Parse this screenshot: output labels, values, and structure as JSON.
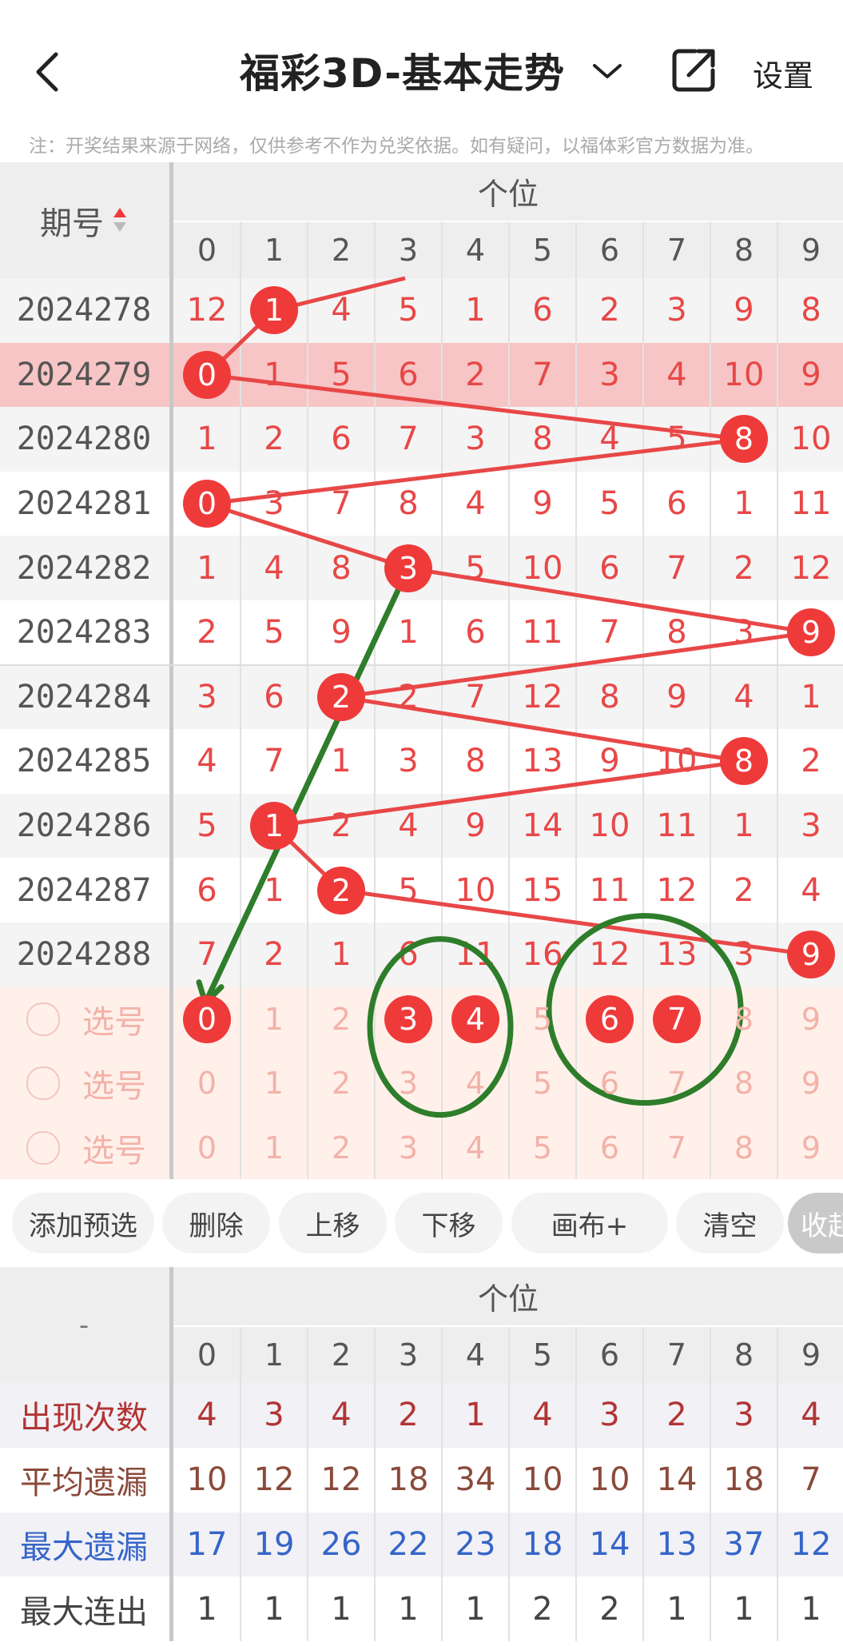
{
  "header": {
    "title": "福彩3D-基本走势",
    "settings_label": "设置",
    "note": "注：开奖结果来源于网络，仅供参考不作为兑奖依据。如有疑问，以福体彩官方数据为准。"
  },
  "table": {
    "period_header": "期号",
    "group_header": "个位",
    "digits": [
      "0",
      "1",
      "2",
      "3",
      "4",
      "5",
      "6",
      "7",
      "8",
      "9"
    ],
    "rows": [
      {
        "period": "2024278",
        "winner": 1,
        "cells": [
          "12",
          "1",
          "4",
          "5",
          "1",
          "6",
          "2",
          "3",
          "9",
          "8"
        ]
      },
      {
        "period": "2024279",
        "winner": 0,
        "cells": [
          "0",
          "1",
          "5",
          "6",
          "2",
          "7",
          "3",
          "4",
          "10",
          "9"
        ],
        "highlight": true
      },
      {
        "period": "2024280",
        "winner": 8,
        "cells": [
          "1",
          "2",
          "6",
          "7",
          "3",
          "8",
          "4",
          "5",
          "8",
          "10"
        ]
      },
      {
        "period": "2024281",
        "winner": 0,
        "cells": [
          "0",
          "3",
          "7",
          "8",
          "4",
          "9",
          "5",
          "6",
          "1",
          "11"
        ]
      },
      {
        "period": "2024282",
        "winner": 3,
        "cells": [
          "1",
          "4",
          "8",
          "3",
          "5",
          "10",
          "6",
          "7",
          "2",
          "12"
        ]
      },
      {
        "period": "2024283",
        "winner": 9,
        "cells": [
          "2",
          "5",
          "9",
          "1",
          "6",
          "11",
          "7",
          "8",
          "3",
          "9"
        ]
      },
      {
        "period": "2024284",
        "winner": 2,
        "cells": [
          "3",
          "6",
          "2",
          "2",
          "7",
          "12",
          "8",
          "9",
          "4",
          "1"
        ]
      },
      {
        "period": "2024285",
        "winner": 8,
        "cells": [
          "4",
          "7",
          "1",
          "3",
          "8",
          "13",
          "9",
          "10",
          "8",
          "2"
        ]
      },
      {
        "period": "2024286",
        "winner": 1,
        "cells": [
          "5",
          "1",
          "2",
          "4",
          "9",
          "14",
          "10",
          "11",
          "1",
          "3"
        ]
      },
      {
        "period": "2024287",
        "winner": 2,
        "cells": [
          "6",
          "1",
          "2",
          "5",
          "10",
          "15",
          "11",
          "12",
          "2",
          "4"
        ]
      },
      {
        "period": "2024288",
        "winner": 9,
        "cells": [
          "7",
          "2",
          "1",
          "6",
          "11",
          "16",
          "12",
          "13",
          "3",
          "9"
        ]
      }
    ],
    "pick_rows": [
      {
        "label": "选号",
        "cells": [
          "0",
          "1",
          "2",
          "3",
          "4",
          "5",
          "6",
          "7",
          "8",
          "9"
        ],
        "selected": [
          0,
          3,
          4,
          6,
          7
        ]
      },
      {
        "label": "选号",
        "cells": [
          "0",
          "1",
          "2",
          "3",
          "4",
          "5",
          "6",
          "7",
          "8",
          "9"
        ],
        "selected": []
      },
      {
        "label": "选号",
        "cells": [
          "0",
          "1",
          "2",
          "3",
          "4",
          "5",
          "6",
          "7",
          "8",
          "9"
        ],
        "selected": []
      }
    ]
  },
  "buttons": [
    "添加预选",
    "删除",
    "上移",
    "下移",
    "画布+",
    "清空",
    "收起"
  ],
  "stats": {
    "corner": "-",
    "group_header": "个位",
    "digits": [
      "0",
      "1",
      "2",
      "3",
      "4",
      "5",
      "6",
      "7",
      "8",
      "9"
    ],
    "rows": [
      {
        "label": "出现次数",
        "color": "#b23434",
        "values": [
          "4",
          "3",
          "4",
          "2",
          "1",
          "4",
          "3",
          "2",
          "3",
          "4"
        ]
      },
      {
        "label": "平均遗漏",
        "color": "#8a4a3a",
        "values": [
          "10",
          "12",
          "12",
          "18",
          "34",
          "10",
          "10",
          "14",
          "18",
          "7"
        ]
      },
      {
        "label": "最大遗漏",
        "color": "#3565c8",
        "values": [
          "17",
          "19",
          "26",
          "22",
          "23",
          "18",
          "14",
          "13",
          "37",
          "12"
        ]
      },
      {
        "label": "最大连出",
        "color": "#444444",
        "values": [
          "1",
          "1",
          "1",
          "1",
          "1",
          "2",
          "2",
          "1",
          "1",
          "1"
        ]
      }
    ]
  },
  "colors": {
    "ball": "#ef3a3a",
    "trend_line": "#e84747",
    "annotation": "#2e7d2a",
    "highlight_row": "#f7c5c5",
    "pick_bg": "#fff0ea"
  }
}
